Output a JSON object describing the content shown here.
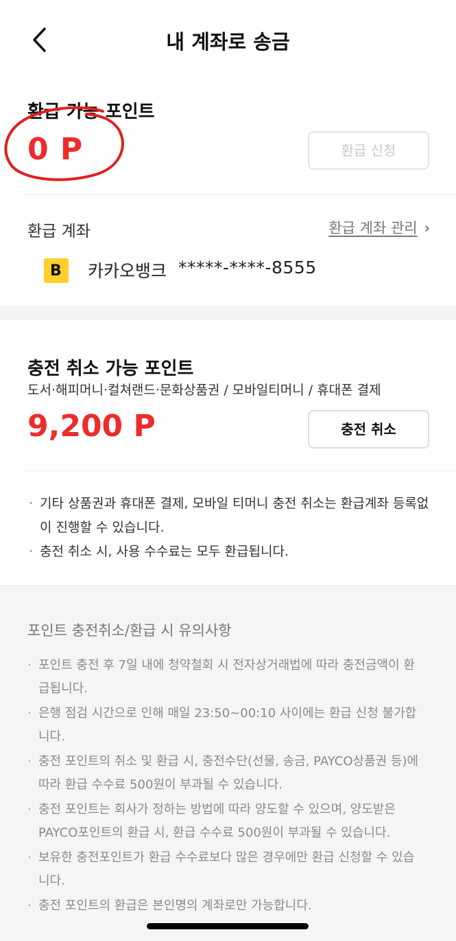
{
  "header": {
    "title": "내 계좌로 송금"
  },
  "refund": {
    "label": "환급 가능 포인트",
    "value": "0 P",
    "button": "환급 신청"
  },
  "account": {
    "label": "환급 계좌",
    "manage": "환급 계좌 관리",
    "manage_chevron": "›",
    "bank_logo_letter": "B",
    "bank_name": "카카오뱅크",
    "number": "*****-****-8555"
  },
  "charge_cancel": {
    "title": "충전 취소 가능 포인트",
    "subtitle": "도서·해피머니·컬쳐랜드·문화상품권 / 모바일티머니 / 휴대폰 결제",
    "value": "9,200 P",
    "button": "충전 취소",
    "info": [
      "기타 상품권과 휴대폰 결제, 모바일 티머니 충전 취소는 환급계좌 등록없이 진행할 수 있습니다.",
      "충전 취소 시, 사용 수수료는 모두 환급됩니다."
    ]
  },
  "notice": {
    "title": "포인트 충전취소/환급 시 유의사항",
    "items": [
      "포인트 충전 후 7일 내에 청약철회 시 전자상거래법에 따라 충전금액이 환급됩니다.",
      "은행 점검 시간으로 인해 매일 23:50~00:10 사이에는 환급 신청 불가합니다.",
      "충전 포인트의 취소 및 환급 시, 충전수단(선물, 송금, PAYCO상품권 등)에 따라 환급 수수료 500원이 부과될 수 있습니다.",
      "충전 포인트는 회사가 정하는 방법에 따라 양도할 수 있으며, 양도받은 PAYCO포인트의 환급 시, 환급 수수료 500원이 부과될 수 있습니다.",
      "보유한 충전포인트가 환급 수수료보다 많은 경우에만 환급 신청할 수 있습니다.",
      "충전 포인트의 환급은 본인명의 계좌로만 가능합니다."
    ]
  },
  "colors": {
    "accent_red": "#ef2b2b",
    "bank_yellow": "#ffd02b",
    "notice_bg": "#f5f5f7"
  },
  "icons": {
    "back": "chevron-left-icon",
    "bank": "kakaobank-logo-icon"
  }
}
